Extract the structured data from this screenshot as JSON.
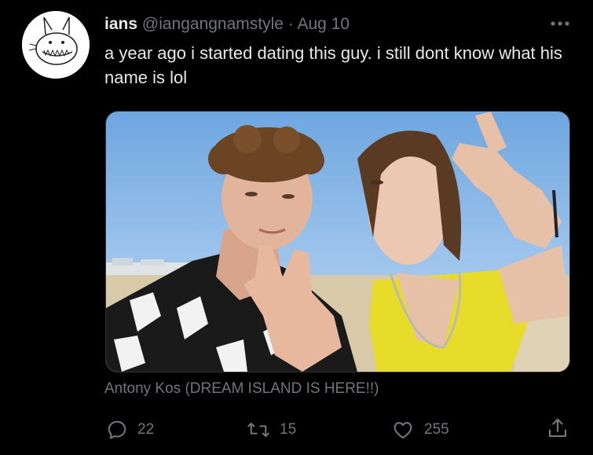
{
  "tweet": {
    "display_name": "ians",
    "handle": "@iangangnamstyle",
    "separator": "·",
    "date": "Aug 10",
    "text": "a year ago i started dating this guy. i still dont know what his name is lol",
    "media_credit": "Antony Kos (DREAM ISLAND IS HERE!!)"
  },
  "actions": {
    "reply_count": "22",
    "retweet_count": "15",
    "like_count": "255"
  },
  "icons": {
    "more": "more-dots-icon",
    "reply": "reply-bubble-icon",
    "retweet": "retweet-icon",
    "like": "heart-icon",
    "share": "share-upload-icon"
  },
  "colors": {
    "background": "#000000",
    "text_primary": "#e7e9ea",
    "text_secondary": "#71767b"
  }
}
